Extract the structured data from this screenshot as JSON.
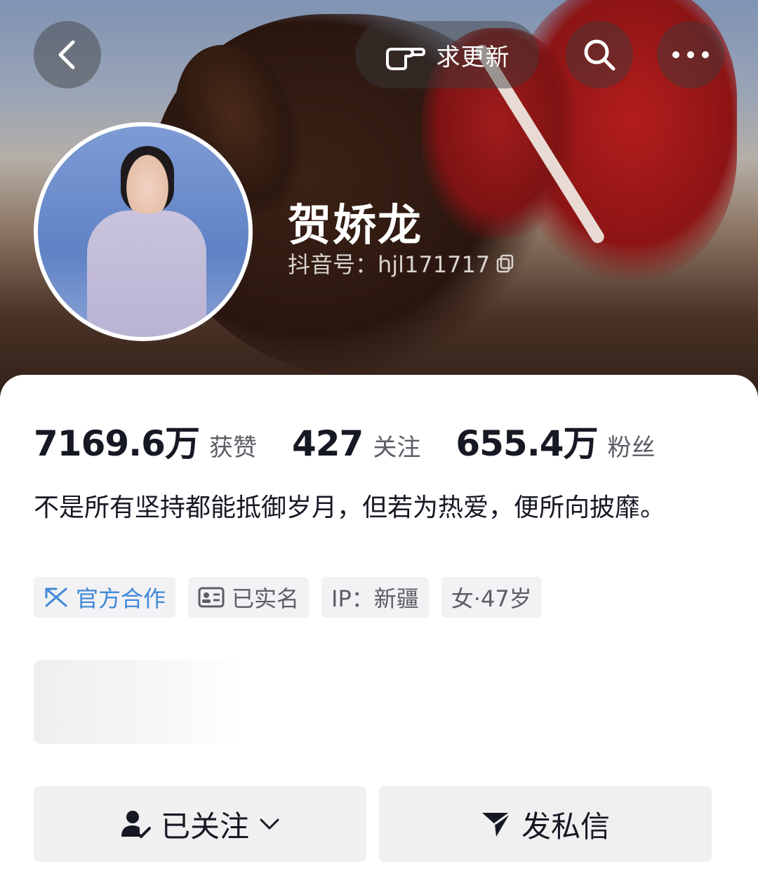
{
  "header": {
    "update_request_label": "求更新"
  },
  "profile": {
    "name": "贺娇龙",
    "douyin_id": "抖音号：hjl171717"
  },
  "stats": {
    "likes_value": "7169.6万",
    "likes_label": "获赞",
    "following_value": "427",
    "following_label": "关注",
    "followers_value": "655.4万",
    "followers_label": "粉丝"
  },
  "bio": "不是所有坚持都能抵御岁月，但若为热爱，便所向披靡。",
  "tags": {
    "official": "官方合作",
    "verified": "已实名",
    "ip": "IP：新疆",
    "gender_age": "女·47岁"
  },
  "actions": {
    "follow_label": "已关注",
    "message_label": "发私信"
  },
  "colors": {
    "accent_blue": "#3f88d8",
    "text_primary": "#161823",
    "text_secondary": "#5c5e66",
    "tag_bg": "#f2f2f4"
  },
  "icons": {
    "back": "back-chevron-icon",
    "update": "pointing-hand-icon",
    "search": "search-icon",
    "more": "more-dots-icon",
    "copy": "copy-icon",
    "official": "official-collab-icon",
    "id_card": "id-card-icon",
    "follow_user": "user-check-icon",
    "dropdown": "chevron-down-icon",
    "send": "send-icon"
  }
}
